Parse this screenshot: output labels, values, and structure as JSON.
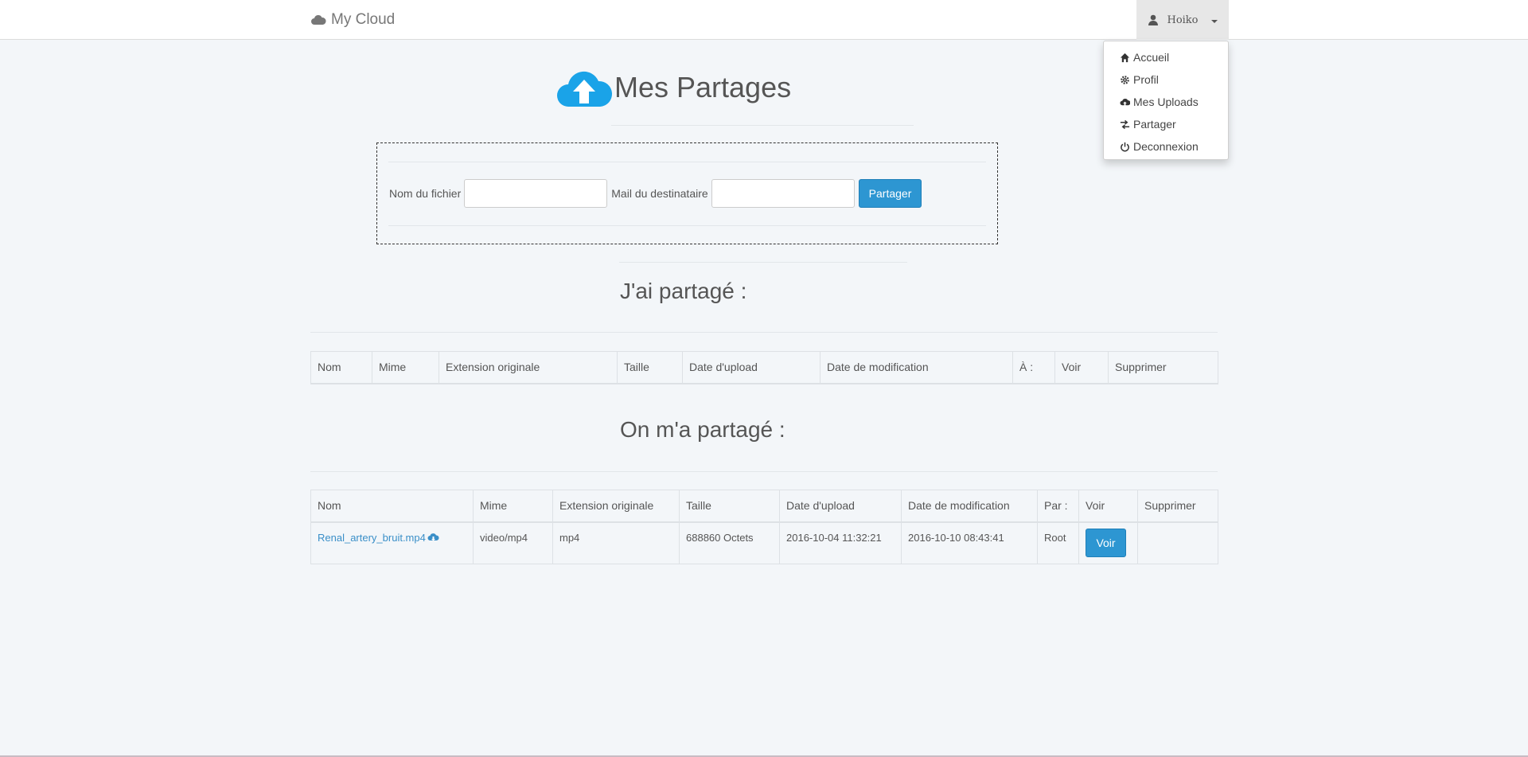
{
  "navbar": {
    "brand": "My Cloud",
    "brand_icon": "cloud-icon",
    "user_name": "Hoiko",
    "user_icon": "user-icon"
  },
  "user_menu": {
    "items": [
      {
        "label": "Accueil",
        "icon": "home-icon"
      },
      {
        "label": "Profil",
        "icon": "gear-icon"
      },
      {
        "label": "Mes Uploads",
        "icon": "cloud-upload-icon"
      },
      {
        "label": "Partager",
        "icon": "transfer-icon"
      },
      {
        "label": "Deconnexion",
        "icon": "power-icon"
      }
    ]
  },
  "page": {
    "title": "Mes Partages",
    "title_icon": "cloud-upload-icon",
    "accent_color": "#1aa3e8"
  },
  "share_form": {
    "file_label": "Nom du fichier",
    "file_value": "",
    "mail_label": "Mail du destinataire",
    "mail_value": "",
    "submit_label": "Partager"
  },
  "shared_by_me": {
    "title": "J'ai partagé :",
    "columns": [
      "Nom",
      "Mime",
      "Extension originale",
      "Taille",
      "Date d'upload",
      "Date de modification",
      "À :",
      "Voir",
      "Supprimer"
    ],
    "rows": []
  },
  "shared_with_me": {
    "title": "On m'a partagé :",
    "columns": [
      "Nom",
      "Mime",
      "Extension originale",
      "Taille",
      "Date d'upload",
      "Date de modification",
      "Par :",
      "Voir",
      "Supprimer"
    ],
    "rows": [
      {
        "nom": "Renal_artery_bruit.mp4",
        "mime": "video/mp4",
        "extension": "mp4",
        "taille": "688860 Octets",
        "date_upload": "2016-10-04 11:32:21",
        "date_modification": "2016-10-10 08:43:41",
        "par": "Root",
        "voir_label": "Voir",
        "supprimer": ""
      }
    ]
  }
}
